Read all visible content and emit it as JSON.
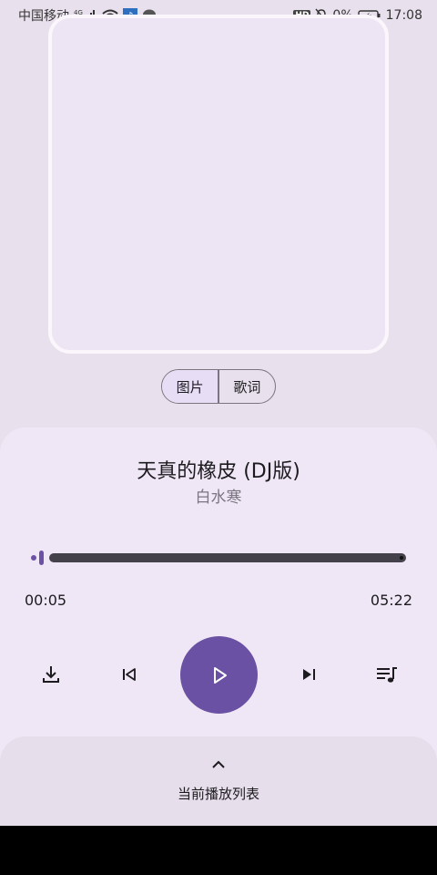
{
  "status_bar": {
    "carrier": "中国移动",
    "network": "4G",
    "hd": "HD",
    "battery_percent": "0%",
    "time": "17:08"
  },
  "view_toggle": {
    "options": [
      "图片",
      "歌词"
    ],
    "selected": "图片"
  },
  "song": {
    "title": "天真的橡皮 (DJ版)",
    "artist": "白水寒"
  },
  "progress": {
    "current_time": "00:05",
    "total_time": "05:22"
  },
  "controls": {
    "download": "download-icon",
    "previous": "skip-previous-icon",
    "play": "play-icon",
    "next": "skip-next-icon",
    "queue": "queue-music-icon"
  },
  "playlist_sheet": {
    "label": "当前播放列表"
  },
  "colors": {
    "accent": "#6a51a3",
    "background": "#e8e0ec",
    "card": "#efe7f5"
  }
}
